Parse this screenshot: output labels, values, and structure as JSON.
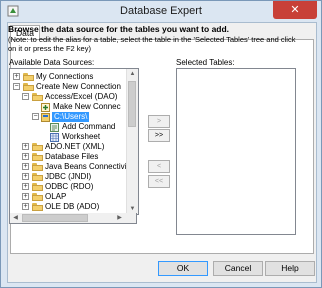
{
  "window": {
    "title": "Database Expert",
    "close_label": "✕"
  },
  "tab": {
    "label": "Data"
  },
  "heading": "Browse the data source for the tables you want to add.",
  "note": "(Note: to edit the alias for a table, select the table in the 'Selected Tables' tree and click on it or press the F2 key)",
  "available_label": "Available Data Sources:",
  "selected_label": "Selected Tables:",
  "tree": [
    {
      "label": "My Connections",
      "expander": "+"
    },
    {
      "label": "Create New Connection",
      "expander": "−"
    },
    {
      "label": "Access/Excel (DAO)",
      "expander": "−"
    },
    {
      "label": "Make New Connec"
    },
    {
      "label": "C:\\Users\\",
      "expander": "−"
    },
    {
      "label": "Add Command"
    },
    {
      "label": "Worksheet"
    },
    {
      "label": "ADO.NET (XML)",
      "expander": "+"
    },
    {
      "label": "Database Files",
      "expander": "+"
    },
    {
      "label": "Java Beans Connectivit",
      "expander": "+"
    },
    {
      "label": "JDBC (JNDI)",
      "expander": "+"
    },
    {
      "label": "ODBC (RDO)",
      "expander": "+"
    },
    {
      "label": "OLAP",
      "expander": "+"
    },
    {
      "label": "OLE DB (ADO)",
      "expander": "+"
    }
  ],
  "move_buttons": {
    "add_one": ">",
    "add_all": ">>",
    "remove_one": "<",
    "remove_all": "<<"
  },
  "buttons": {
    "ok": "OK",
    "cancel": "Cancel",
    "help": "Help"
  }
}
